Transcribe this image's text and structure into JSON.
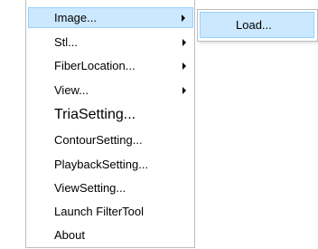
{
  "menu": {
    "items": [
      {
        "label": "Image...",
        "has_submenu": true,
        "highlighted": true
      },
      {
        "label": "Stl...",
        "has_submenu": true
      },
      {
        "label": "FiberLocation...",
        "has_submenu": true
      },
      {
        "label": "View...",
        "has_submenu": true
      },
      {
        "label": "TriaSetting..."
      },
      {
        "label": "ContourSetting..."
      },
      {
        "label": "PlaybackSetting..."
      },
      {
        "label": "ViewSetting..."
      },
      {
        "label": "Launch FilterTool"
      },
      {
        "label": "About"
      }
    ]
  },
  "submenu": {
    "items": [
      {
        "label": "Load...",
        "highlighted": true
      }
    ]
  },
  "colors": {
    "highlight_background": "#cce8ff",
    "highlight_border": "#99d1ff",
    "menu_border": "#bdbdbd"
  }
}
